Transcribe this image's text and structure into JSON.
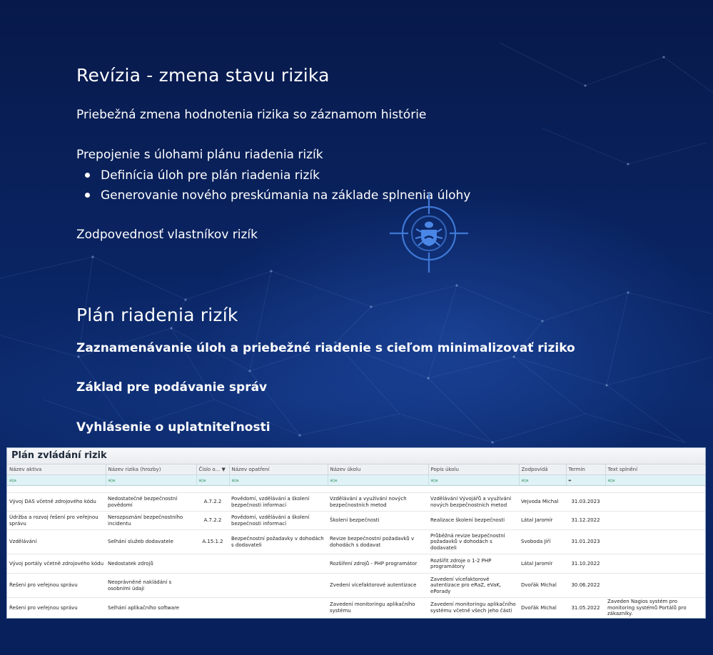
{
  "section1": {
    "heading": "Revízia - zmena stavu rizika",
    "line1": "Priebežná zmena hodnotenia rizika so záznamom histórie",
    "line2": "Prepojenie s úlohami plánu riadenia rizík",
    "bullets": [
      "Definícia úloh pre plán riadenia rizík",
      "Generovanie nového preskúmania na základe splnenia úlohy"
    ],
    "line3": "Zodpovednosť vlastníkov rizík"
  },
  "section2": {
    "heading": "Plán riadenia rizík",
    "items": [
      "Zaznamenávanie úloh a priebežné riadenie s cieľom minimalizovať riziko",
      "Základ pre podávanie správ",
      "Vyhlásenie o uplatniteľnosti"
    ]
  },
  "icons": {
    "decor": "bug-target-icon",
    "filter": "filter-icon"
  },
  "colors": {
    "background": "#0a2462",
    "filter_row": "#dff3f7"
  },
  "app": {
    "title": "Plán zvládání rizik",
    "filter_glyph": "≡▯≤",
    "columns": [
      "Název aktiva",
      "Název rizika (hrozby)",
      "Číslo o... ▼",
      "Název opatření",
      "Název úkolu",
      "Popis úkolu",
      "Zodpovídá",
      "Termín",
      "Text splnění"
    ],
    "rows": [
      [
        "Vývoj DAS včetně zdrojového kódu",
        "Nedostatečné bezpečnostní povědomí",
        "A.7.2.2",
        "Povědomí, vzdělávání a školení bezpečnosti informací",
        "Vzdělávání a využívání nových bezpečnostních metod",
        "Vzdělávání Vývojářů a využívání nových bezpečnostních metod",
        "Vejvoda Michal",
        "31.03.2023",
        ""
      ],
      [
        "Údržba a rozvoj řešení pro veřejnou správu",
        "Nerozpoznání bezpečnostního incidentu",
        "A.7.2.2",
        "Povědomí, vzdělávání a školení bezpečnosti informací",
        "Školení bezpečnosti",
        "Realizace školení bezpečnosti",
        "Látal Jaromír",
        "31.12.2022",
        ""
      ],
      [
        "Vzdělávání",
        "Selhání služeb dodavatele",
        "A.15.1.2",
        "Bezpečnostní požadavky v dohodách s dodavateli",
        "Revize bezpečnostní požadavků v dohodách s dodavat",
        "Průběžná revize bezpečnostní požadavků v dohodách s dodavateli",
        "Svoboda Jiří",
        "31.01.2023",
        ""
      ],
      [
        "Vývoj portály včetně zdrojového kódu",
        "Nedostatek zdrojů",
        "",
        "",
        "Rozšíření zdrojů - PHP programátor",
        "Rozšířit zdroje o 1-2 PHP programátory",
        "Látal Jaromír",
        "31.10.2022",
        ""
      ],
      [
        "Řešení pro veřejnou správu",
        "Neoprávněné nakládání s osobními údaji",
        "",
        "",
        "Zvedení vícefaktorové autentizace",
        "Zavedení vícefaktorové autentizace pro eRaZ, eVaK, ePorady",
        "Dvořák Michal",
        "30.06.2022",
        ""
      ],
      [
        "Řešení pro veřejnou správu",
        "Selhání aplikačního software",
        "",
        "",
        "Zavedení monitoringu aplikačního systému",
        "Zavedení monitoringu aplikačního systému včetně všech jeho částí",
        "Dvořák Michal",
        "31.05.2022",
        "Zaveden Nagios systém pro monitoring systémů Portálů pro zákazníky."
      ]
    ]
  }
}
